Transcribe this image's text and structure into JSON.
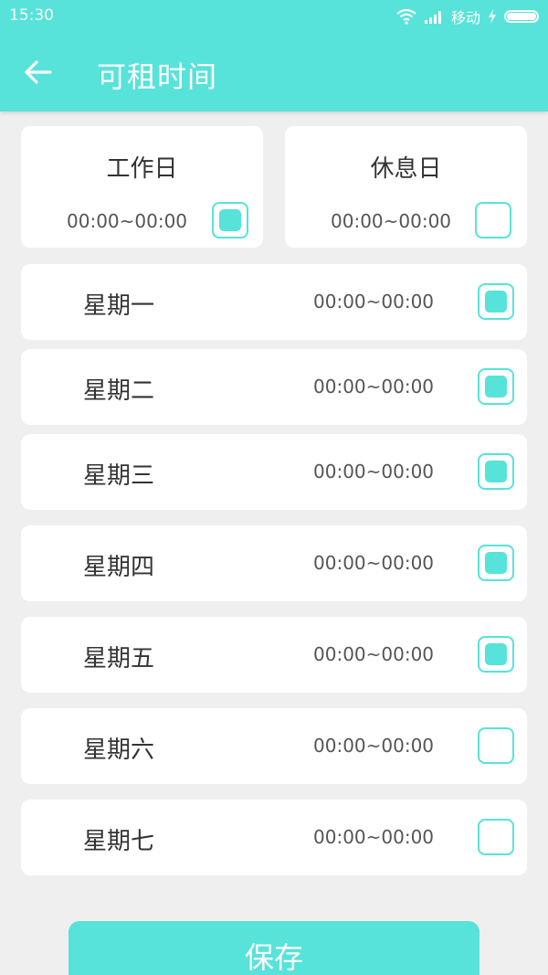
{
  "status_bar": {
    "time": "15:30",
    "carrier": "移动"
  },
  "header": {
    "title": "可租时间"
  },
  "groups": [
    {
      "label": "工作日",
      "time": "00:00~00:00",
      "checked": true
    },
    {
      "label": "休息日",
      "time": "00:00~00:00",
      "checked": false
    }
  ],
  "days": [
    {
      "label": "星期一",
      "time": "00:00~00:00",
      "checked": true
    },
    {
      "label": "星期二",
      "time": "00:00~00:00",
      "checked": true
    },
    {
      "label": "星期三",
      "time": "00:00~00:00",
      "checked": true
    },
    {
      "label": "星期四",
      "time": "00:00~00:00",
      "checked": true
    },
    {
      "label": "星期五",
      "time": "00:00~00:00",
      "checked": true
    },
    {
      "label": "星期六",
      "time": "00:00~00:00",
      "checked": false
    },
    {
      "label": "星期七",
      "time": "00:00~00:00",
      "checked": false
    }
  ],
  "save_label": "保存",
  "colors": {
    "accent": "#57e3d9",
    "background": "#efefef",
    "card": "#ffffff"
  },
  "icons": {
    "back": "arrow-left-icon",
    "wifi": "wifi-icon",
    "signal": "signal-icon",
    "charging": "lightning-icon",
    "battery": "battery-icon"
  }
}
